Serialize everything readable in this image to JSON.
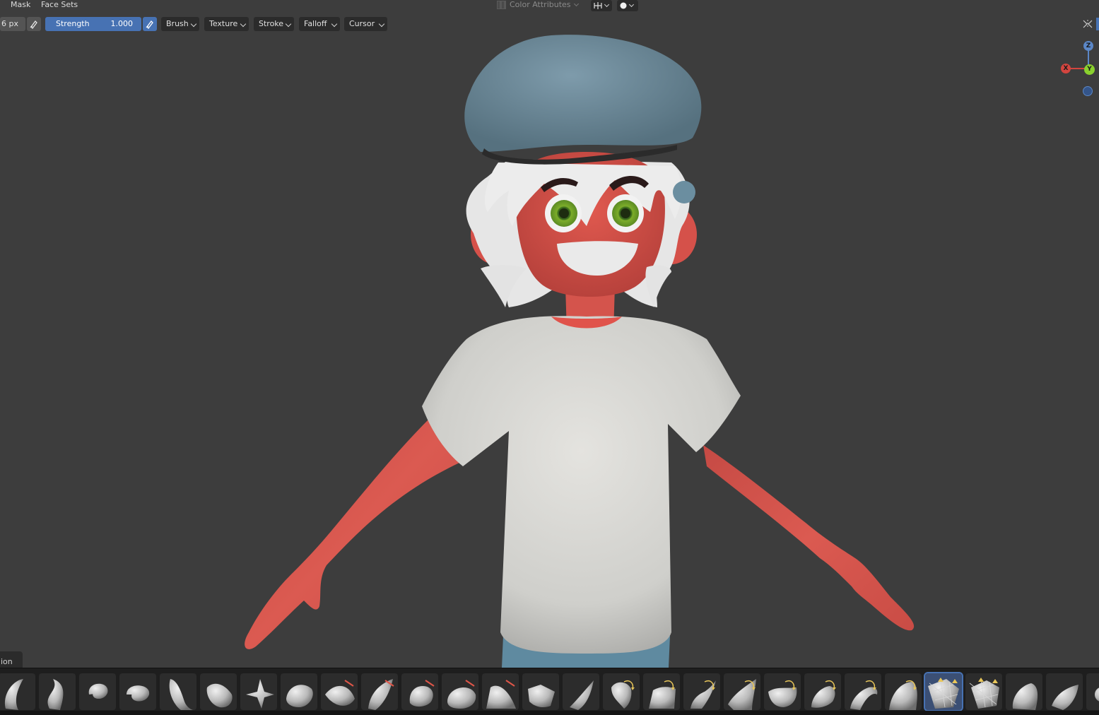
{
  "menu": {
    "mask": "Mask",
    "face_sets": "Face Sets"
  },
  "header_center": {
    "color_attributes": "Color Attributes"
  },
  "toolbar": {
    "radius_value": "6 px",
    "strength_label": "Strength",
    "strength_value": "1.000",
    "dropdowns": [
      "Brush",
      "Texture",
      "Stroke",
      "Falloff",
      "Cursor"
    ]
  },
  "gizmo": {
    "z": "Z",
    "x": "X",
    "y": "Y"
  },
  "bottom_tab": "ion",
  "brushes": [
    "draw-brush",
    "draw-sharp-brush",
    "clay-brush",
    "clay-strips-brush",
    "clay-thumb-brush",
    "layer-brush",
    "inflate-brush",
    "blob-brush",
    "crease-brush",
    "smooth-brush",
    "flatten-brush",
    "fill-brush",
    "scrape-brush",
    "multiplane-scrape-brush",
    "pinch-brush",
    "grab-brush",
    "elastic-deform-brush",
    "snake-hook-brush",
    "thumb-brush",
    "pose-brush",
    "nudge-brush",
    "rotate-brush",
    "slide-relax-brush",
    "boundary-brush",
    "cloth-brush",
    "simplify-brush",
    "mask-brush",
    "draw-face-sets-brush"
  ],
  "active_brush_index": 23,
  "colors": {
    "accent": "#4772b3",
    "viewport_bg": "#3d3d3d",
    "skin": "#d9524a",
    "hat": "#6f8fa0",
    "shirt": "#d6d6d3"
  }
}
